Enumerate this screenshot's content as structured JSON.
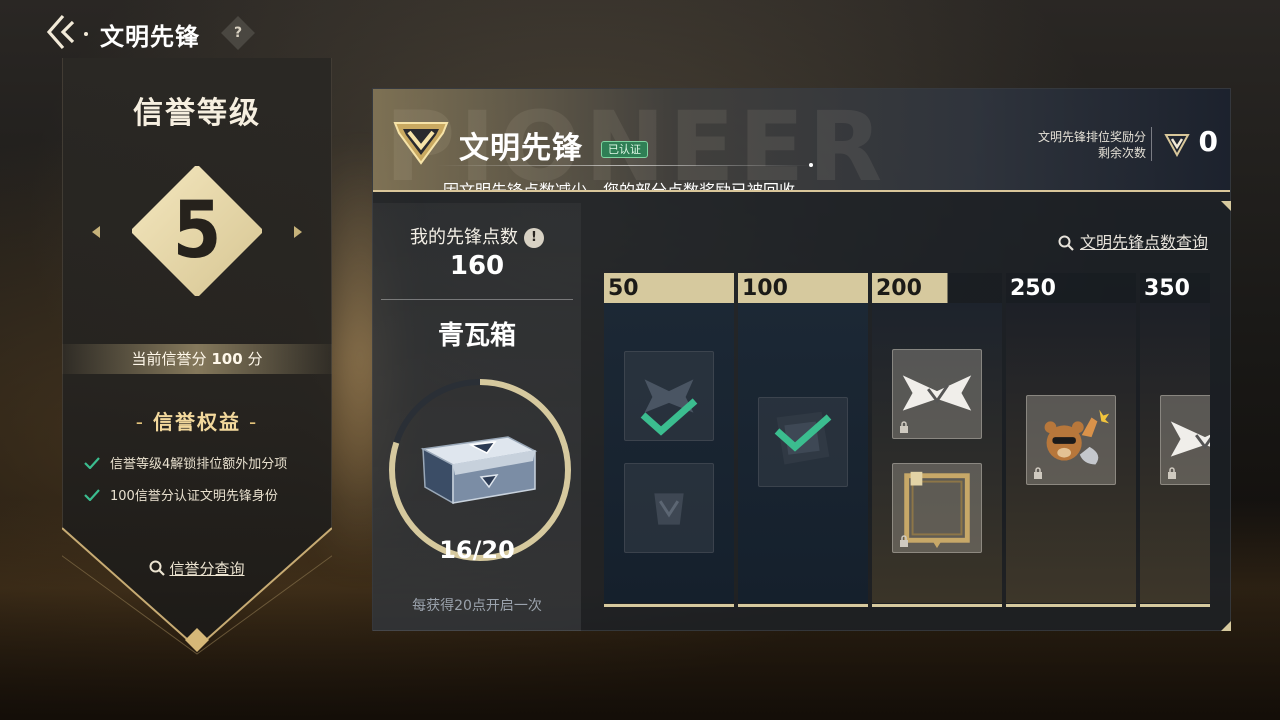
{
  "header": {
    "title": "文明先锋",
    "help_symbol": "?"
  },
  "credit": {
    "title": "信誉等级",
    "level": "5",
    "score_prefix": "当前信誉分",
    "score_value": "100",
    "score_suffix": "分",
    "rights_title": "信誉权益",
    "benefits": [
      "信誉等级4解锁排位额外加分项",
      "100信誉分认证文明先锋身份"
    ],
    "query_label": "信誉分查询"
  },
  "pioneer": {
    "bg_word": "PIONEER",
    "name": "文明先锋",
    "verified_badge": "已认证",
    "notice": "因文明先锋点数减少，您的部分点数奖励已被回收",
    "reward_label_line1": "文明先锋排位奖励分",
    "reward_label_line2": "剩余次数",
    "reward_count": "0",
    "points_label": "我的先锋点数",
    "points_info_symbol": "!",
    "points_value": "160",
    "points_query_label": "文明先锋点数查询",
    "box": {
      "name": "青瓦箱",
      "progress_text": "16/20",
      "progress_fraction": 0.8,
      "hint": "每获得20点开启一次"
    },
    "tiers": [
      {
        "threshold": "50",
        "state": "reached"
      },
      {
        "threshold": "100",
        "state": "reached"
      },
      {
        "threshold": "200",
        "state": "partial"
      },
      {
        "threshold": "250",
        "state": "locked"
      },
      {
        "threshold": "350",
        "state": "locked"
      }
    ]
  },
  "colors": {
    "gold": "#d6c99e",
    "check_green": "#3bbd8f",
    "verified_green": "#2f7f55"
  }
}
